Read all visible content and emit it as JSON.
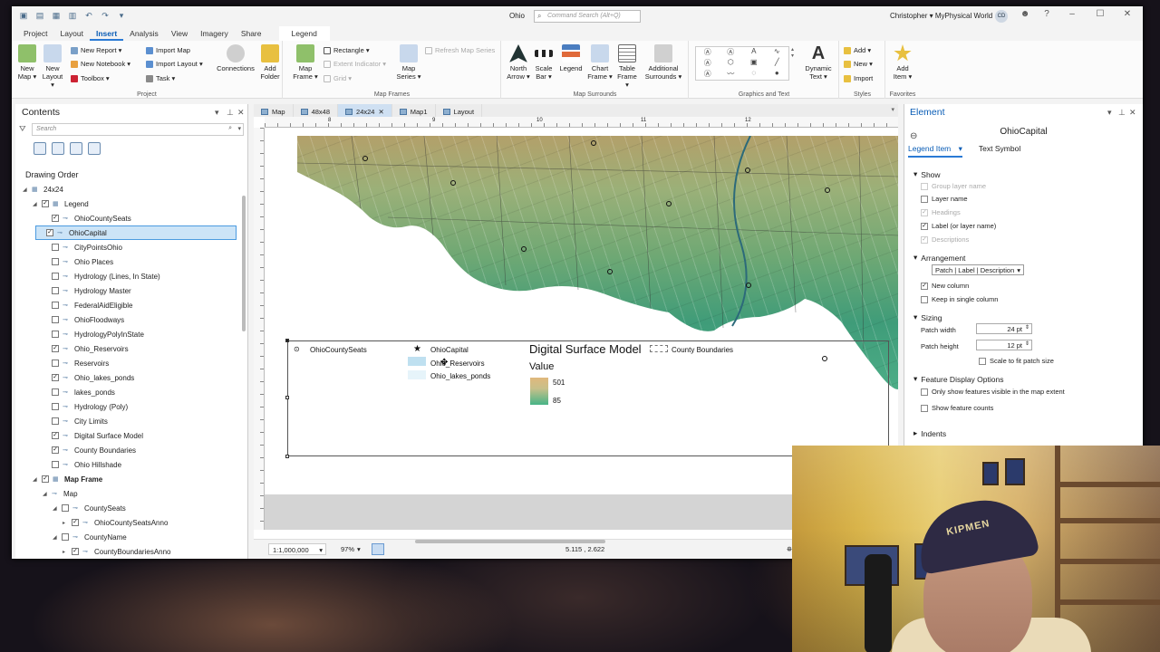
{
  "titlebar": {
    "project": "Ohio",
    "search_placeholder": "Command Search (Alt+Q)",
    "user": "Christopher  ▾  MyPhysical World",
    "initials": "CD"
  },
  "tabs": [
    "Project",
    "Layout",
    "Insert",
    "Analysis",
    "View",
    "Imagery",
    "Share",
    "Legend"
  ],
  "ribbon": {
    "project": {
      "label": "Project",
      "new_map": "New Map ▾",
      "new_layout": "New Layout ▾",
      "new_report": "New Report ▾",
      "new_notebook": "New Notebook ▾",
      "toolbox": "Toolbox ▾",
      "import_map": "Import Map",
      "import_layout": "Import Layout ▾",
      "task": "Task ▾",
      "connections": "Connections",
      "add_folder": "Add Folder"
    },
    "map_frames": {
      "label": "Map Frames",
      "map_frame": "Map Frame ▾",
      "rectangle": "Rectangle ▾",
      "extent_indicator": "Extent Indicator ▾",
      "grid": "Grid ▾",
      "map_series": "Map Series ▾",
      "refresh": "Refresh Map Series"
    },
    "map_surrounds": {
      "label": "Map Surrounds",
      "north_arrow": "North Arrow ▾",
      "scale_bar": "Scale Bar ▾",
      "legend": "Legend",
      "chart_frame": "Chart Frame ▾",
      "table_frame": "Table Frame ▾",
      "additional": "Additional Surrounds ▾"
    },
    "graphics": {
      "label": "Graphics and Text",
      "dynamic_text": "Dynamic Text ▾"
    },
    "styles": {
      "label": "Styles",
      "add": "Add ▾",
      "new": "New ▾",
      "import": "Import"
    },
    "favorites": {
      "label": "Favorites",
      "add_item": "Add Item ▾"
    }
  },
  "contents": {
    "title": "Contents",
    "search_placeholder": "Search",
    "drawing_order": "Drawing Order",
    "items": [
      {
        "label": "24x24",
        "level": 0,
        "check": null,
        "exp": "◢"
      },
      {
        "label": "Legend",
        "level": 1,
        "check": true,
        "exp": "◢"
      },
      {
        "label": "OhioCountySeats",
        "level": 2,
        "check": true,
        "exp": ""
      },
      {
        "label": "OhioCapital",
        "level": 2,
        "check": true,
        "exp": "",
        "sel": true
      },
      {
        "label": "CityPointsOhio",
        "level": 2,
        "check": false,
        "exp": ""
      },
      {
        "label": "Ohio Places",
        "level": 2,
        "check": false,
        "exp": ""
      },
      {
        "label": "Hydrology (Lines, In State)",
        "level": 2,
        "check": false,
        "exp": ""
      },
      {
        "label": "Hydrology Master",
        "level": 2,
        "check": false,
        "exp": ""
      },
      {
        "label": "FederalAidEligible",
        "level": 2,
        "check": false,
        "exp": ""
      },
      {
        "label": "OhioFloodways",
        "level": 2,
        "check": false,
        "exp": ""
      },
      {
        "label": "HydrologyPolyInState",
        "level": 2,
        "check": false,
        "exp": ""
      },
      {
        "label": "Ohio_Reservoirs",
        "level": 2,
        "check": true,
        "exp": ""
      },
      {
        "label": "Reservoirs",
        "level": 2,
        "check": false,
        "exp": ""
      },
      {
        "label": "Ohio_lakes_ponds",
        "level": 2,
        "check": true,
        "exp": ""
      },
      {
        "label": "lakes_ponds",
        "level": 2,
        "check": false,
        "exp": ""
      },
      {
        "label": "Hydrology (Poly)",
        "level": 2,
        "check": false,
        "exp": ""
      },
      {
        "label": "City Limits",
        "level": 2,
        "check": false,
        "exp": ""
      },
      {
        "label": "Digital Surface Model",
        "level": 2,
        "check": true,
        "exp": ""
      },
      {
        "label": "County Boundaries",
        "level": 2,
        "check": true,
        "exp": ""
      },
      {
        "label": "Ohio Hillshade",
        "level": 2,
        "check": false,
        "exp": ""
      },
      {
        "label": "Map Frame",
        "level": 1,
        "check": true,
        "exp": "◢",
        "bold": true
      },
      {
        "label": "Map",
        "level": 2,
        "check": null,
        "exp": "◢"
      },
      {
        "label": "CountySeats",
        "level": 3,
        "check": false,
        "exp": "◢"
      },
      {
        "label": "OhioCountySeatsAnno",
        "level": 4,
        "check": true,
        "exp": "▸"
      },
      {
        "label": "CountyName",
        "level": 3,
        "check": false,
        "exp": "◢"
      },
      {
        "label": "CountyBoundariesAnno",
        "level": 4,
        "check": true,
        "exp": "▸"
      }
    ]
  },
  "layout_tabs": [
    {
      "label": "Map",
      "active": false
    },
    {
      "label": "48x48",
      "active": false
    },
    {
      "label": "24x24",
      "active": true
    },
    {
      "label": "Map1",
      "active": false
    },
    {
      "label": "Layout",
      "active": false
    }
  ],
  "legend": {
    "county_seats": "OhioCountySeats",
    "capital": "OhioCapital",
    "reservoirs": "Ohio_Reservoirs",
    "lakes": "Ohio_lakes_ponds",
    "dsm_title": "Digital Surface Model",
    "value": "Value",
    "high": "501",
    "low": "85",
    "county_boundaries": "County Boundaries"
  },
  "ruler_ticks": [
    "8",
    "9",
    "10",
    "11",
    "12"
  ],
  "status": {
    "scale": "1:1,000,000",
    "zoom": "97%",
    "coords": "5.115 , 2.622",
    "sel": "Se"
  },
  "element": {
    "title": "Element",
    "layer": "OhioCapital",
    "tab_legend_item": "Legend Item",
    "tab_text_symbol": "Text Symbol",
    "show": "Show",
    "group_layer_name": "Group layer name",
    "layer_name": "Layer name",
    "headings": "Headings",
    "label": "Label (or layer name)",
    "descriptions": "Descriptions",
    "arrangement": "Arrangement",
    "arrangement_value": "Patch | Label | Description",
    "new_column": "New column",
    "keep_single": "Keep in single column",
    "sizing": "Sizing",
    "patch_width": "Patch width",
    "patch_width_val": "24 pt",
    "patch_height": "Patch height",
    "patch_height_val": "12 pt",
    "scale_to_fit": "Scale to fit patch size",
    "feature_display": "Feature Display Options",
    "only_show": "Only show features visible in the map extent",
    "show_counts": "Show feature counts",
    "indents": "Indents"
  },
  "webcam": {
    "cap_text": "KIPMEN"
  },
  "colors": {
    "accent": "#2a7ad5",
    "selection": "#cce4f7",
    "dsm_high": "#e0b87c",
    "dsm_low": "#47b487"
  }
}
